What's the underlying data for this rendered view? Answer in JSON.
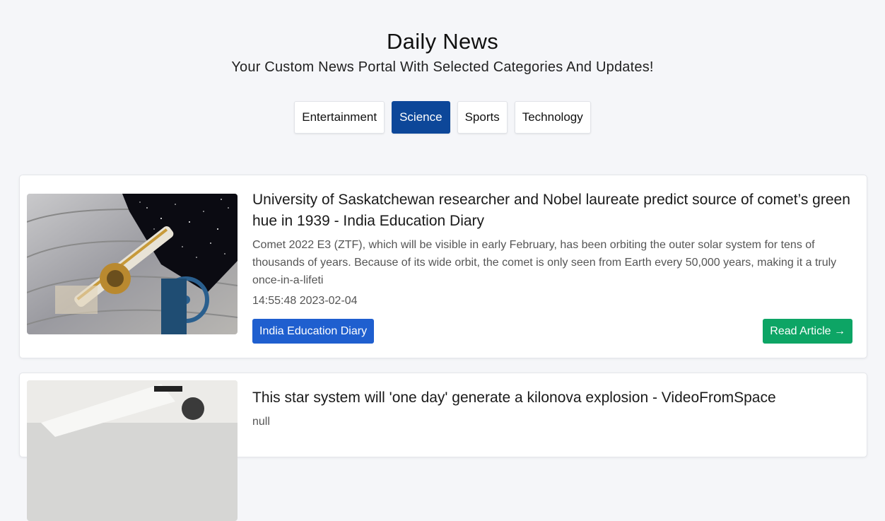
{
  "header": {
    "title": "Daily News",
    "subtitle": "Your Custom News Portal With Selected Categories And Updates!"
  },
  "tabs": [
    {
      "label": "Entertainment",
      "active": false
    },
    {
      "label": "Science",
      "active": true
    },
    {
      "label": "Sports",
      "active": false
    },
    {
      "label": "Technology",
      "active": false
    }
  ],
  "articles": [
    {
      "title": "University of Saskatchewan researcher and Nobel laureate predict source of comet’s green hue in 1939 - India Education Diary",
      "description": "Comet 2022 E3 (ZTF), which will be visible in early February, has been orbiting the outer solar system for tens of thousands of years. Because of its wide orbit, the comet is only seen from Earth every 50,000 years, making it a truly once-in-a-lifeti",
      "date": "14:55:48 2023-02-04",
      "source": "India Education Diary",
      "read_label": "Read Article →"
    },
    {
      "title": "This star system will 'one day' generate a kilonova explosion - VideoFromSpace",
      "description": "null"
    }
  ],
  "colors": {
    "active_tab": "#0d4799",
    "source_badge": "#1f5fcf",
    "read_button": "#0da565"
  }
}
